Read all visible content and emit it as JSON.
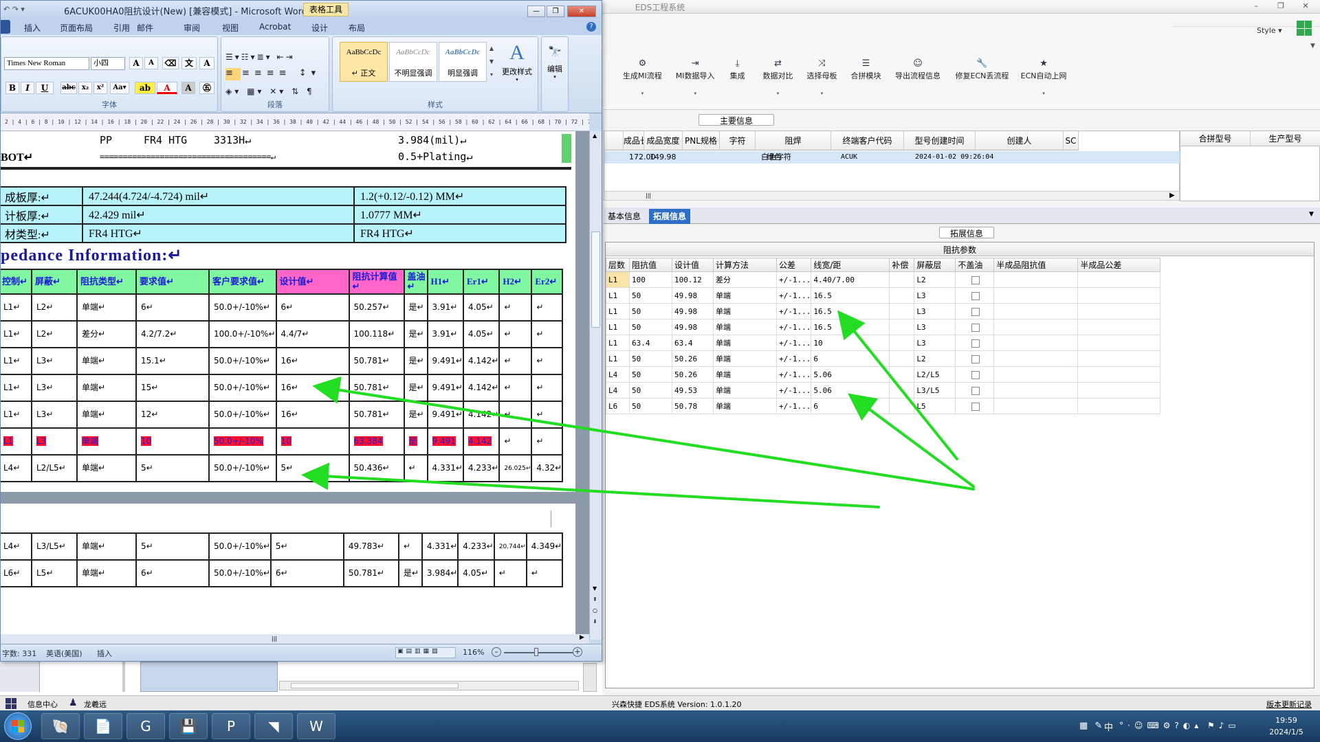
{
  "eds": {
    "title": "EDS工程系统",
    "style_menu": "Style",
    "toolbar": [
      {
        "label": "生成MI流程",
        "icon": "gears-icon"
      },
      {
        "label": "MI数据导入",
        "icon": "import-icon"
      },
      {
        "label": "集成",
        "icon": "download-icon"
      },
      {
        "label": "数据对比",
        "icon": "compare-icon"
      },
      {
        "label": "选择母板",
        "icon": "shuffle-icon"
      },
      {
        "label": "合拼模块",
        "icon": "list-icon"
      },
      {
        "label": "导出流程信息",
        "icon": "smiley-icon"
      },
      {
        "label": "修复ECN丢流程",
        "icon": "wrench-icon"
      },
      {
        "label": "ECN自动上网",
        "icon": "star-icon"
      }
    ],
    "main_section": "主要信息",
    "main_grid": {
      "headers": [
        "成品长度",
        "成品宽度",
        "PNL规格",
        "字符",
        "阻焊",
        "终端客户代码",
        "型号创建时间",
        "创建人",
        "SC"
      ],
      "row": [
        "172.00",
        "149.98",
        "",
        "白色字符",
        "绿色",
        "ACUK",
        "2024-01-02 09:26:04",
        "",
        ""
      ]
    },
    "side_grid": {
      "headers": [
        "合拼型号",
        "生产型号"
      ]
    },
    "tabs": [
      "基本信息",
      "拓展信息"
    ],
    "ext_section": "拓展信息",
    "impedance": {
      "title": "阻抗参数",
      "headers": [
        "层数",
        "阻抗值",
        "设计值",
        "计算方法",
        "公差",
        "线宽/距",
        "补偿",
        "屏蔽层",
        "不盖油",
        "半成品阻抗值",
        "半成品公差"
      ],
      "rows": [
        [
          "L1",
          "100",
          "100.12",
          "差分",
          "+/-1...",
          "4.40/7.00",
          "",
          "L2"
        ],
        [
          "L1",
          "50",
          "49.98",
          "单端",
          "+/-1...",
          "16.5",
          "",
          "L3"
        ],
        [
          "L1",
          "50",
          "49.98",
          "单端",
          "+/-1...",
          "16.5",
          "",
          "L3"
        ],
        [
          "L1",
          "50",
          "49.98",
          "单端",
          "+/-1...",
          "16.5",
          "",
          "L3"
        ],
        [
          "L1",
          "63.4",
          "63.4",
          "单端",
          "+/-1...",
          "10",
          "",
          "L3"
        ],
        [
          "L1",
          "50",
          "50.26",
          "单端",
          "+/-1...",
          "6",
          "",
          "L2"
        ],
        [
          "L4",
          "50",
          "50.26",
          "单端",
          "+/-1...",
          "5.06",
          "",
          "L2/L5"
        ],
        [
          "L4",
          "50",
          "49.53",
          "单端",
          "+/-1...",
          "5.06",
          "",
          "L3/L5"
        ],
        [
          "L6",
          "50",
          "50.78",
          "单端",
          "+/-1...",
          "6",
          "",
          "L5"
        ]
      ]
    },
    "status": {
      "version": "兴森快捷 EDS系统 Version: 1.0.1.20",
      "changelog": "版本更新记录"
    },
    "left_status": {
      "info": "信息中心",
      "user": "龙羲远"
    }
  },
  "word": {
    "title": "6ACUK00HA0阻抗设计(New) [兼容模式] - Microsoft Word",
    "context_tab": "表格工具",
    "tabs": [
      "插入",
      "页面布局",
      "引用",
      "邮件",
      "审阅",
      "视图",
      "Acrobat",
      "设计",
      "布局"
    ],
    "font_name": "Times New Roman",
    "font_size": "小四",
    "styles": [
      {
        "sample": "AaBbCcDc",
        "name": "↵ 正文"
      },
      {
        "sample": "AaBbCcDc",
        "name": "不明显强调"
      },
      {
        "sample": "AaBbCcDc",
        "name": "明显强调"
      }
    ],
    "change_style": "更改样式",
    "edit": "编辑",
    "groups": {
      "font": "字体",
      "paragraph": "段落",
      "styles": "样式"
    },
    "ruler": "2 | 4 | 6 | 8 | 10 | 12 | 14 | 16 | 18 | 20 | 22 | 24 | 26 | 28 | 30 | 32 | 34 | 36 | 38 | 40 | 42 | 44 | 46 | 48 | 50 | 52 | 54 | 56 | 58 | 60 | 62 | 64 | 66 | 68 | 70 | 72 | 74 | 76 | 78 | 80 | 82 | 84 | 86 | 88 | 90 | 92 | 94 | 96 | 98 | 100 | 102 | 104 | 106 | 108 | 110 | 112 | 114 | 116 | 118 | 120 | 122 | 124 | 126 | 128 | 130 | 132 | 134 | 136 | 138 | 140 | 142 | 144 | 146 | 148 | 150 | 152 | 15",
    "doc": {
      "pp_line": {
        "a": "PP",
        "b": "FR4 HTG",
        "c": "3313H↵",
        "d": "3.984(mil)↵"
      },
      "bot_line": {
        "a": "BOT↵",
        "b": "=====================================↵",
        "d": "0.5+Plating↵"
      },
      "stack": [
        [
          "成板厚:↵",
          "47.244(4.724/-4.724) mil↵",
          "1.2(+0.12/-0.12) MM↵"
        ],
        [
          "计板厚:↵",
          "42.429 mil↵",
          "1.0777 MM↵"
        ],
        [
          "材类型:↵",
          "FR4 HTG↵",
          "FR4 HTG↵"
        ]
      ],
      "heading": "pedance Information:↵",
      "table_headers": [
        "控制↵",
        "屏蔽↵",
        "阻抗类型↵",
        "要求值↵",
        "客户要求值↵",
        "设计值↵",
        "阻抗计算值↵",
        "盖油↵",
        "H1↵",
        "Er1↵",
        "H2↵",
        "Er2↵"
      ],
      "rows": [
        [
          "L1↵",
          "L2↵",
          "单端↵",
          "6↵",
          "50.0+/-10%↵",
          "6↵",
          "50.257↵",
          "是↵",
          "3.91↵",
          "4.05↵",
          "↵",
          "↵"
        ],
        [
          "L1↵",
          "L2↵",
          "差分↵",
          "4.2/7.2↵",
          "100.0+/-10%↵",
          "4.4/7↵",
          "100.118↵",
          "是↵",
          "3.91↵",
          "4.05↵",
          "↵",
          "↵"
        ],
        [
          "L1↵",
          "L3↵",
          "单端↵",
          "15.1↵",
          "50.0+/-10%↵",
          "16↵",
          "50.781↵",
          "是↵",
          "9.491↵",
          "4.142↵",
          "↵",
          "↵"
        ],
        [
          "L1↵",
          "L3↵",
          "单端↵",
          "15↵",
          "50.0+/-10%↵",
          "16↵",
          "50.781↵",
          "是↵",
          "9.491↵",
          "4.142↵",
          "↵",
          "↵"
        ],
        [
          "L1↵",
          "L3↵",
          "单端↵",
          "12↵",
          "50.0+/-10%↵",
          "16↵",
          "50.781↵",
          "是↵",
          "9.491↵",
          "4.142↵",
          "↵",
          "↵"
        ],
        [
          "L1",
          "L3",
          "单端",
          "10",
          "50.0+/-10%",
          "10",
          "63.384",
          "是",
          "9.491",
          "4.142",
          "↵",
          "↵"
        ],
        [
          "L4↵",
          "L2/L5↵",
          "单端↵",
          "5↵",
          "50.0+/-10%↵",
          "5↵",
          "50.436↵",
          "↵",
          "4.331↵",
          "4.233↵",
          "26.025↵",
          "4.32↵"
        ]
      ],
      "rows2": [
        [
          "L4↵",
          "L3/L5↵",
          "单端↵",
          "5↵",
          "50.0+/-10%↵",
          "5↵",
          "49.783↵",
          "↵",
          "4.331↵",
          "4.233↵",
          "20.744↵",
          "4.349↵"
        ],
        [
          "L6↵",
          "L5↵",
          "单端↵",
          "6↵",
          "50.0+/-10%↵",
          "6↵",
          "50.781↵",
          "是↵",
          "3.984↵",
          "4.05↵",
          "↵",
          "↵"
        ]
      ]
    },
    "status": {
      "words": "字数: 331",
      "lang": "英语(美国)",
      "mode": "插入",
      "zoom": "116%"
    }
  },
  "taskbar": {
    "apps": [
      "explorer-icon",
      "notepad-icon",
      "foxit-icon",
      "save-disk-icon",
      "pads-icon",
      "tool-icon",
      "word-icon"
    ],
    "ime": "中",
    "time": "19:59",
    "date": "2024/1/5"
  },
  "colors": {
    "arrow": "#22dd22",
    "stack_bg": "#b7f3fb",
    "header_green": "#80f7a0",
    "header_pink": "#ff66c7",
    "highlight_red": "#ff0f2e",
    "tab_active": "#2d6ec6"
  }
}
